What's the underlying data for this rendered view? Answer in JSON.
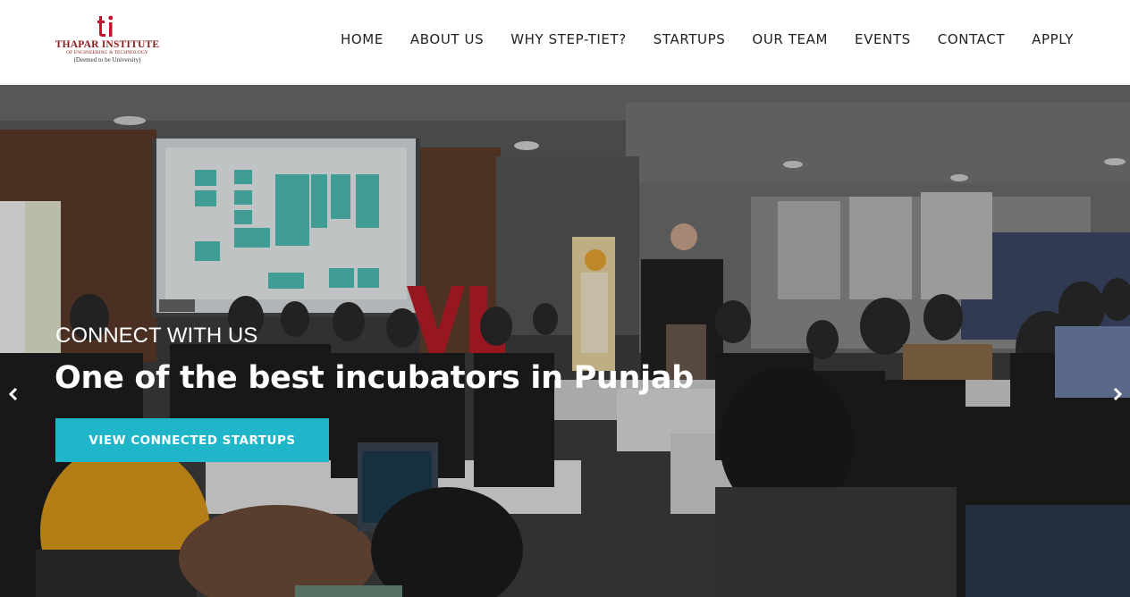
{
  "logo": {
    "name": "THAPAR INSTITUTE",
    "subtitle": "OF ENGINEERING & TECHNOLOGY",
    "tagline": "(Deemed to be University)",
    "mark": "ti",
    "brand_color": "#8b1a1a"
  },
  "nav": {
    "items": [
      {
        "label": "HOME"
      },
      {
        "label": "ABOUT US"
      },
      {
        "label": "WHY STEP-TIET?"
      },
      {
        "label": "STARTUPS"
      },
      {
        "label": "OUR TEAM"
      },
      {
        "label": "EVENTS"
      },
      {
        "label": "CONTACT"
      },
      {
        "label": "APPLY"
      }
    ]
  },
  "hero": {
    "kicker": "CONNECT WITH US",
    "title": "One of the best incubators in Punjab",
    "button_label": "VIEW CONNECTED STARTUPS",
    "button_color": "#1fb6c9",
    "prev_icon": "chevron-left-icon",
    "next_icon": "chevron-right-icon"
  }
}
